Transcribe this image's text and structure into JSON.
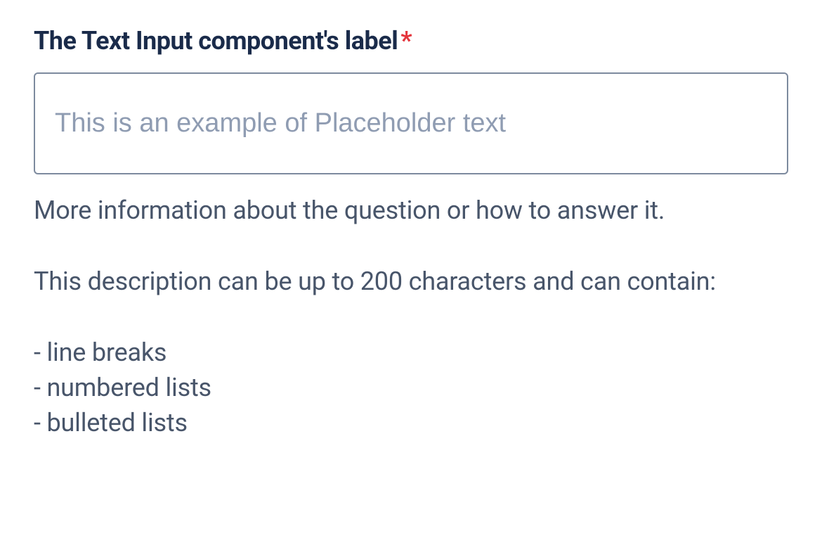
{
  "field": {
    "label": "The Text Input component's label",
    "required_mark": "*",
    "placeholder": "This is an example of Placeholder text",
    "value": "",
    "description": "More information about the question or how to answer it.\n\nThis description can be up to 200 characters and can contain:\n\n- line breaks\n- numbered lists\n- bulleted lists"
  }
}
